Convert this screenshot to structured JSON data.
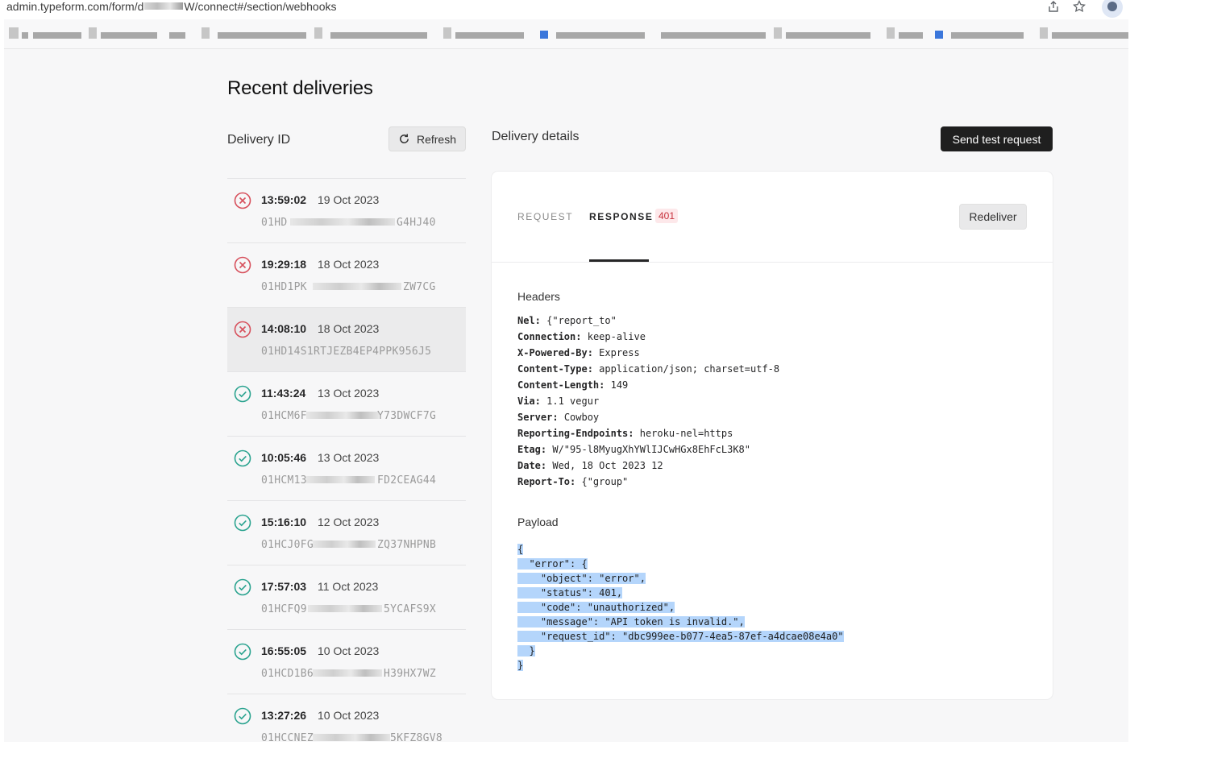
{
  "browser": {
    "url_prefix": "admin.typeform.com/form/d",
    "url_suffix": "W/connect#/section/webhooks",
    "share_icon": "share-icon",
    "star_icon": "star-icon",
    "profile_icon": "profile-icon"
  },
  "page": {
    "title": "Recent deliveries",
    "delivery_id_label": "Delivery ID",
    "refresh_label": "Refresh",
    "details_label": "Delivery details",
    "send_test_label": "Send test request"
  },
  "deliveries": [
    {
      "time": "13:59:02",
      "date": "19 Oct 2023",
      "id_start": "01HD",
      "id_end": "G4HJ40",
      "status": "error"
    },
    {
      "time": "19:29:18",
      "date": "18 Oct 2023",
      "id_start": "01HD1PK",
      "id_end": "ZW7CG",
      "status": "error"
    },
    {
      "time": "14:08:10",
      "date": "18 Oct 2023",
      "id_start": "01HD14S1RTJEZB4EP4PPK956J5",
      "id_end": "",
      "status": "error",
      "selected": true
    },
    {
      "time": "11:43:24",
      "date": "13 Oct 2023",
      "id_start": "01HCM6F",
      "id_end": "Y73DWCF7G",
      "status": "success"
    },
    {
      "time": "10:05:46",
      "date": "13 Oct 2023",
      "id_start": "01HCM13",
      "id_end": "FD2CEAG44",
      "status": "success"
    },
    {
      "time": "15:16:10",
      "date": "12 Oct 2023",
      "id_start": "01HCJ0FG",
      "id_end": "ZQ37NHPNB",
      "status": "success"
    },
    {
      "time": "17:57:03",
      "date": "11 Oct 2023",
      "id_start": "01HCFQ9",
      "id_end": "5YCAFS9X",
      "status": "success"
    },
    {
      "time": "16:55:05",
      "date": "10 Oct 2023",
      "id_start": "01HCD1B6",
      "id_end": "H39HX7WZ",
      "status": "success"
    },
    {
      "time": "13:27:26",
      "date": "10 Oct 2023",
      "id_start": "01HCCNEZ",
      "id_end": "5KFZ8GV8",
      "status": "success"
    }
  ],
  "details": {
    "tab_request": "REQUEST",
    "tab_response": "RESPONSE",
    "response_code": "401",
    "redeliver_label": "Redeliver",
    "headers_title": "Headers",
    "headers": [
      {
        "key": "Nel:",
        "value": "{\"report_to\""
      },
      {
        "key": "Connection:",
        "value": "keep-alive"
      },
      {
        "key": "X-Powered-By:",
        "value": "Express"
      },
      {
        "key": "Content-Type:",
        "value": "application/json; charset=utf-8"
      },
      {
        "key": "Content-Length:",
        "value": "149"
      },
      {
        "key": "Via:",
        "value": "1.1 vegur"
      },
      {
        "key": "Server:",
        "value": "Cowboy"
      },
      {
        "key": "Reporting-Endpoints:",
        "value": "heroku-nel=https"
      },
      {
        "key": "Etag:",
        "value": "W/\"95-l8MyugXhYWlIJCwHGx8EhFcL3K8\""
      },
      {
        "key": "Date:",
        "value": "Wed, 18 Oct 2023 12"
      },
      {
        "key": "Report-To:",
        "value": "{\"group\""
      }
    ],
    "payload_title": "Payload",
    "payload_lines": [
      "{",
      "  \"error\": {",
      "    \"object\": \"error\",",
      "    \"status\": 401,",
      "    \"code\": \"unauthorized\",",
      "    \"message\": \"API token is invalid.\",",
      "    \"request_id\": \"dbc999ee-b077-4ea5-87ef-a4dcae08e4a0\"",
      "  }",
      "}"
    ]
  },
  "colors": {
    "error": "#d7505c",
    "success": "#2aa38f",
    "accent_dark": "#1f1f1f",
    "selection": "#b4d5fb"
  }
}
